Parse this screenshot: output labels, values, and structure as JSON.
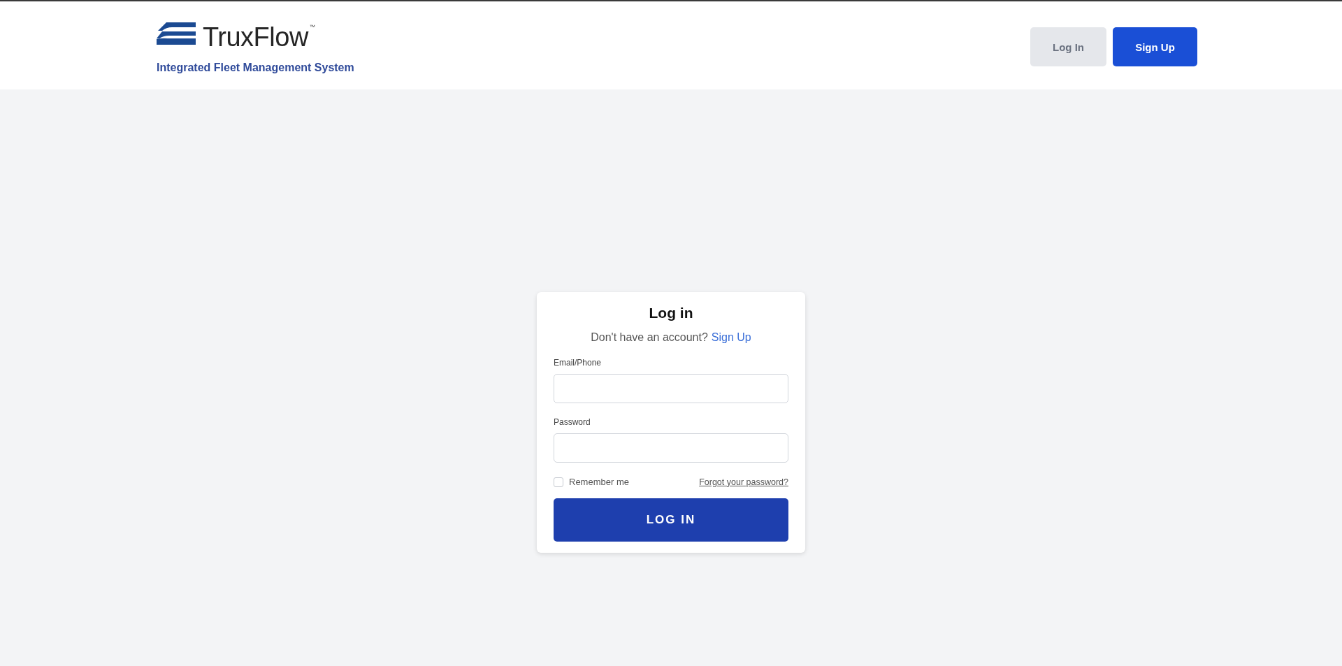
{
  "header": {
    "logo": {
      "name": "TruxFlow",
      "mark": "™"
    },
    "tagline": "Integrated Fleet Management System",
    "buttons": [
      {
        "label": "Log In",
        "kind": "secondary"
      },
      {
        "label": "Sign Up",
        "kind": "primary"
      }
    ]
  },
  "login_card": {
    "title": "Log in",
    "prompt": "Don't have an account?",
    "prompt_link": "Sign Up",
    "fields": [
      {
        "label": "Email/Phone"
      },
      {
        "label": "Password"
      }
    ],
    "remember": {
      "label": "Remember me",
      "checked": false
    },
    "forgot_link": "Forgot your password?",
    "submit": "LOG IN"
  }
}
